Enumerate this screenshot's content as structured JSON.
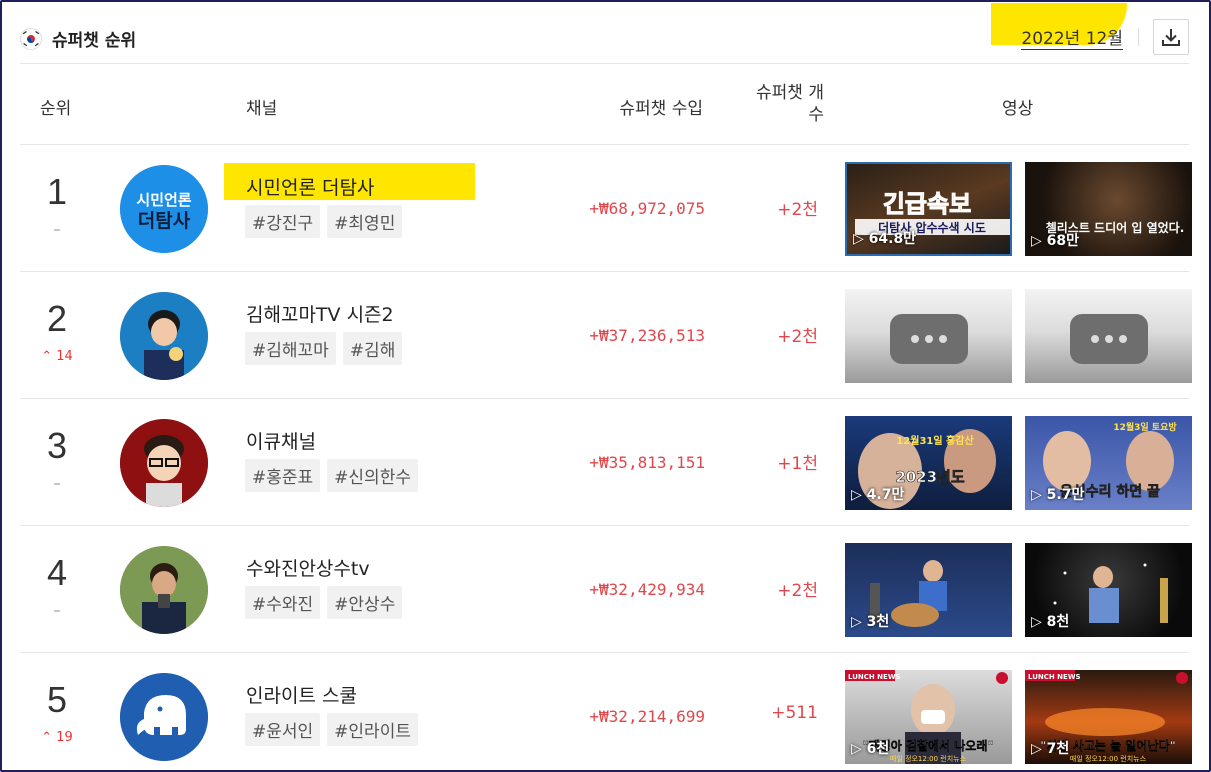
{
  "header": {
    "title": "슈퍼챗 순위",
    "period": "2022년 12월",
    "download_icon": "download-icon",
    "flag_icon": "korea-flag-icon"
  },
  "columns": {
    "rank": "순위",
    "channel": "채널",
    "income": "슈퍼챗 수입",
    "count": "슈퍼챗 개수",
    "video": "영상"
  },
  "rows": [
    {
      "rank": "1",
      "delta": "–",
      "name": "시민언론 더탐사",
      "tags": [
        "#강진구",
        "#최영민"
      ],
      "income": "+₩68,972,075",
      "count": "+2천",
      "videos": [
        {
          "views": "64.8만"
        },
        {
          "views": "68만"
        }
      ]
    },
    {
      "rank": "2",
      "delta": "14",
      "name": "김해꼬마TV 시즌2",
      "tags": [
        "#김해꼬마",
        "#김해"
      ],
      "income": "+₩37,236,513",
      "count": "+2천",
      "videos": [
        {
          "views": ""
        },
        {
          "views": ""
        }
      ]
    },
    {
      "rank": "3",
      "delta": "–",
      "name": "이큐채널",
      "tags": [
        "#홍준표",
        "#신의한수"
      ],
      "income": "+₩35,813,151",
      "count": "+1천",
      "videos": [
        {
          "views": "4.7만"
        },
        {
          "views": "5.7만"
        }
      ]
    },
    {
      "rank": "4",
      "delta": "–",
      "name": "수와진안상수tv",
      "tags": [
        "#수와진",
        "#안상수"
      ],
      "income": "+₩32,429,934",
      "count": "+2천",
      "videos": [
        {
          "views": "3천"
        },
        {
          "views": "8천"
        }
      ]
    },
    {
      "rank": "5",
      "delta": "19",
      "name": "인라이트 스쿨",
      "tags": [
        "#윤서인",
        "#인라이트"
      ],
      "income": "+₩32,214,699",
      "count": "+511",
      "videos": [
        {
          "views": "6천"
        },
        {
          "views": "7천"
        }
      ]
    }
  ],
  "avatar_texts": {
    "r1_top": "시민언론",
    "r1_bottom": "더탐사"
  },
  "thumb_texts": {
    "r1v1_a": "긴급속보",
    "r1v1_b": "더탐사 압수수색 시도",
    "r1v2": "첼리스트 드디어 입 열었다.",
    "r3v1_a": "12월31일 홍감산",
    "r3v1_b": "2023년도",
    "r3v2_a": "12월3일 토요방",
    "r3v2_b": "윤석수리 하면 끝",
    "r5_news": "LUNCH NEWS",
    "r5v1": "\"재명아 검찰에서 나오래\"",
    "r5v2": "\"사건 사고는 늘 일어난다\"",
    "r5_footer": "매일 정오12:00 런치뉴스"
  },
  "colors": {
    "accent_red": "#e0474c",
    "highlight": "#ffe600",
    "border": "#1f1f5c"
  }
}
